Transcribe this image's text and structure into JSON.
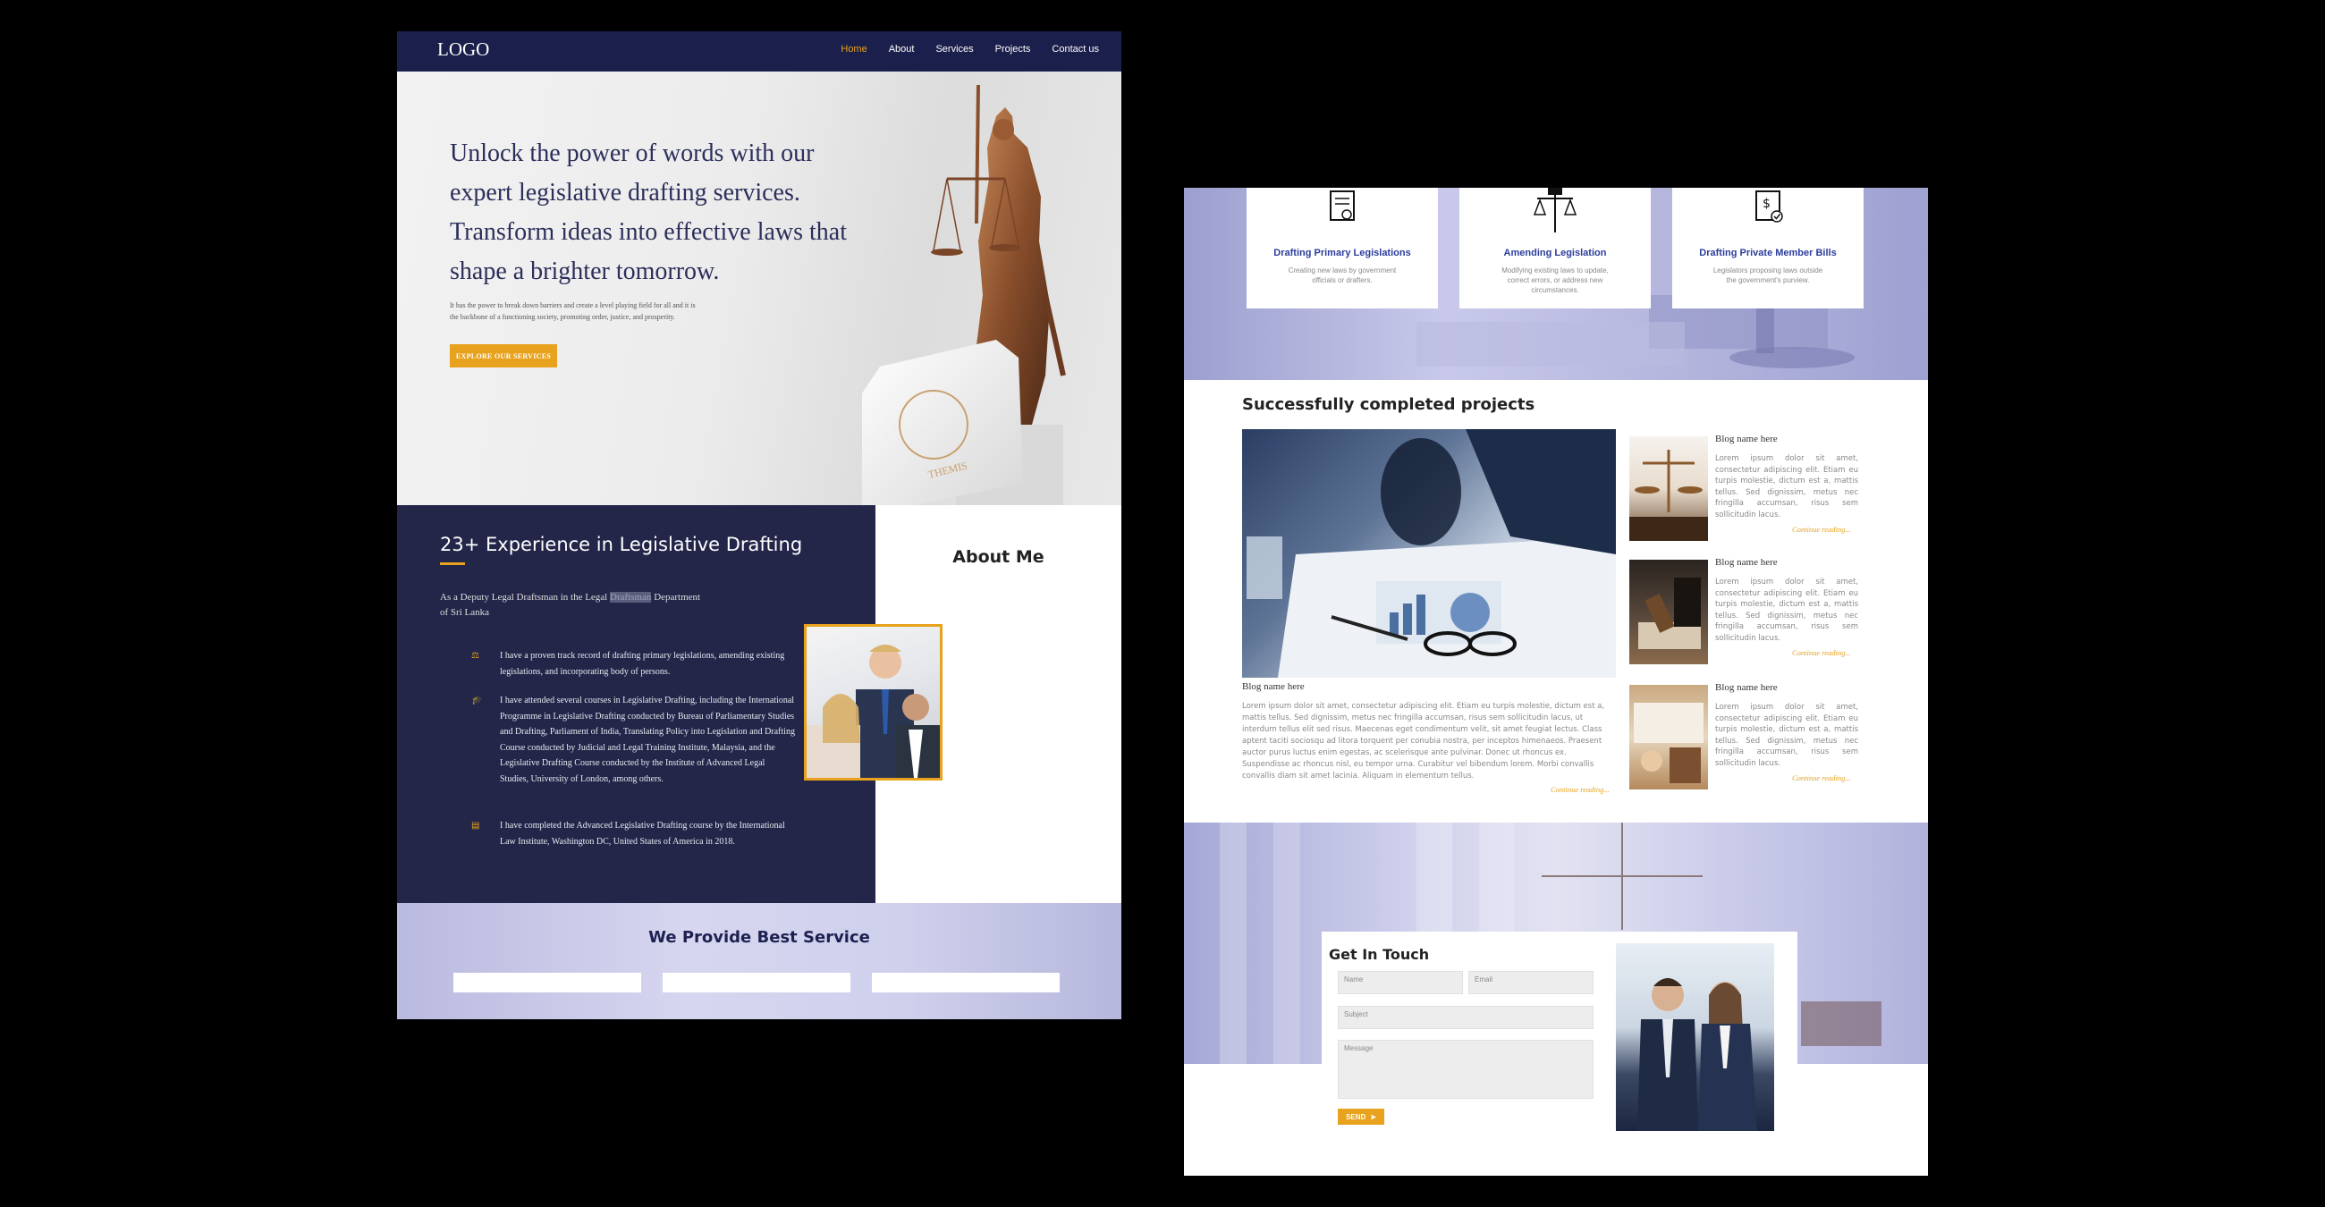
{
  "left": {
    "nav": {
      "logo": "LOGO",
      "links": [
        "Home",
        "About",
        "Services",
        "Projects",
        "Contact us"
      ]
    },
    "hero": {
      "title": "Unlock the power of words with our expert legislative drafting services. Transform ideas into effective laws that shape a brighter tomorrow.",
      "subtitle": "It has the power to break down barriers and create a level playing field for all and it is the backbone of a functioning society, promoting order, justice, and prosperity.",
      "button": "EXPLORE OUR SERVICES",
      "book_text": "THEMIS"
    },
    "experience": {
      "title": "23+ Experience in Legislative Drafting",
      "role_prefix": "As a Deputy Legal Draftsman in the Legal",
      "role_highlight": "Draftsman",
      "role_suffix": "Department of Sri Lanka",
      "achievements": [
        "I have a proven track record of drafting primary legislations, amending existing legislations, and incorporating body of persons.",
        "I have attended several courses in Legislative Drafting, including the International Programme in Legislative Drafting conducted by Bureau of Parliamentary Studies and Drafting, Parliament of India, Translating Policy into Legislation and Drafting Course conducted by Judicial and Legal Training Institute, Malaysia, and the Legislative Drafting Course conducted by the Institute of Advanced Legal Studies, University of London, among others.",
        "I have completed the Advanced Legislative Drafting course by the International Law Institute, Washington DC, United States of America in 2018."
      ],
      "achievement_icons": [
        "scales-icon",
        "graduation-cap-icon",
        "certificate-icon"
      ]
    },
    "about": {
      "title": "About Me"
    },
    "service": {
      "title": "We Provide Best Service"
    }
  },
  "right": {
    "cards": [
      {
        "title": "Drafting Primary Legislations",
        "desc": "Creating new laws by government officials or drafters.",
        "icon": "document-certificate-icon"
      },
      {
        "title": "Amending Legislation",
        "desc": "Modifying existing laws to update, correct errors, or address new circumstances.",
        "icon": "scales-hand-icon"
      },
      {
        "title": "Drafting Private Member Bills",
        "desc": "Legislators proposing laws outside the government's purview.",
        "icon": "dollar-document-icon"
      }
    ],
    "projects": {
      "title": "Successfully completed projects",
      "main_blog": {
        "name": "Blog name here",
        "text": "Lorem ipsum dolor sit amet, consectetur adipiscing elit. Etiam eu turpis molestie, dictum est a, mattis tellus. Sed dignissim, metus nec fringilla accumsan, risus sem sollicitudin lacus, ut interdum tellus elit sed risus. Maecenas eget condimentum velit, sit amet feugiat lectus. Class aptent taciti sociosqu ad litora torquent per conubia nostra, per inceptos himenaeos. Praesent auctor purus luctus enim egestas, ac scelerisque ante pulvinar. Donec ut rhoncus ex. Suspendisse ac rhoncus nisl, eu tempor urna. Curabitur vel bibendum lorem. Morbi convallis convallis diam sit amet lacinia. Aliquam in elementum tellus.",
        "more": "Continue reading..."
      },
      "side_blogs": [
        {
          "name": "Blog name here",
          "text": "Lorem ipsum dolor sit amet, consectetur adipiscing elit. Etiam eu turpis molestie, dictum est a, mattis tellus. Sed dignissim, metus nec fringilla accumsan, risus sem sollicitudin lacus.",
          "more": "Continue reading..."
        },
        {
          "name": "Blog name here",
          "text": "Lorem ipsum dolor sit amet, consectetur adipiscing elit. Etiam eu turpis molestie, dictum est a, mattis tellus. Sed dignissim, metus nec fringilla accumsan, risus sem sollicitudin lacus.",
          "more": "Continue reading..."
        },
        {
          "name": "Blog name here",
          "text": "Lorem ipsum dolor sit amet, consectetur adipiscing elit. Etiam eu turpis molestie, dictum est a, mattis tellus. Sed dignissim, metus nec fringilla accumsan, risus sem sollicitudin lacus.",
          "more": "Continue reading..."
        }
      ]
    },
    "contact": {
      "title": "Get In Touch",
      "name_placeholder": "Name",
      "email_placeholder": "Email",
      "subject_placeholder": "Subject",
      "message_placeholder": "Message",
      "send": "SEND"
    }
  },
  "colors": {
    "navy": "#1b1f4b",
    "panel": "#232649",
    "accent": "#e8a21d",
    "lavender": "#c8c9ea",
    "link_blue": "#2b3c9c"
  }
}
